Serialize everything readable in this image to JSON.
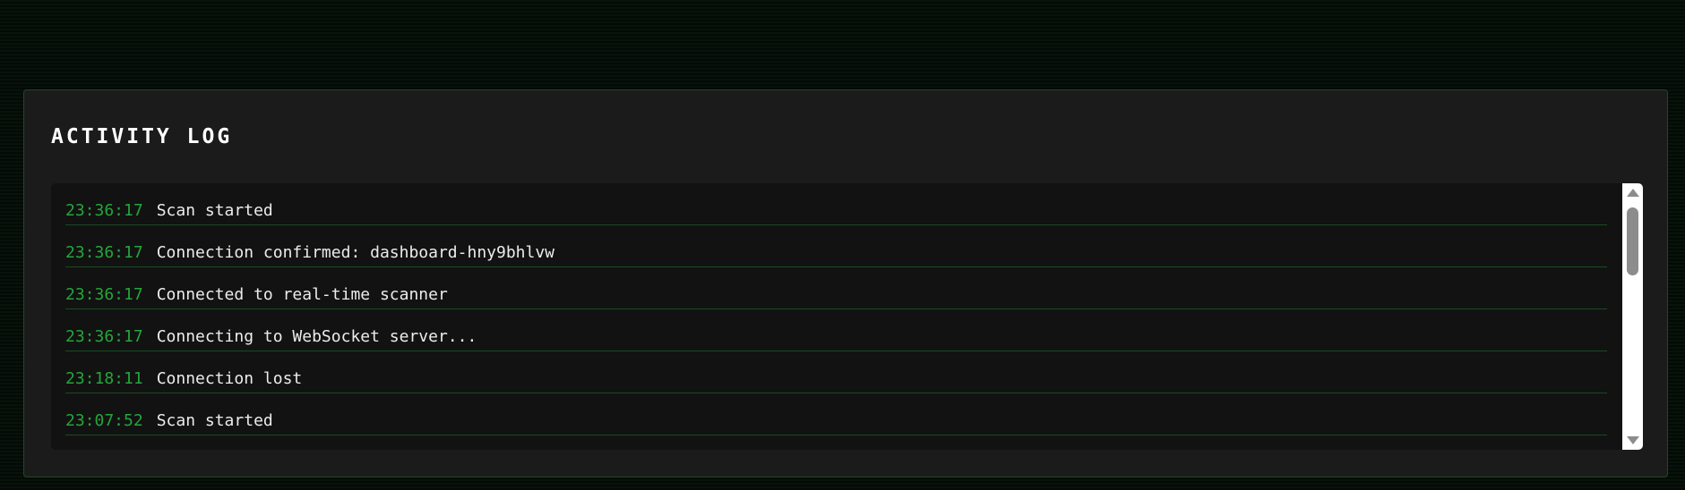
{
  "panel": {
    "title": "ACTIVITY LOG"
  },
  "log": {
    "entries": [
      {
        "time": "23:36:17",
        "message": "Scan started"
      },
      {
        "time": "23:36:17",
        "message": "Connection confirmed: dashboard-hny9bhlvw"
      },
      {
        "time": "23:36:17",
        "message": "Connected to real-time scanner"
      },
      {
        "time": "23:36:17",
        "message": "Connecting to WebSocket server..."
      },
      {
        "time": "23:18:11",
        "message": "Connection lost"
      },
      {
        "time": "23:07:52",
        "message": "Scan started"
      }
    ]
  },
  "colors": {
    "timestamp": "#25a53b",
    "message": "#ececec",
    "panel_border": "#1d4a26",
    "row_divider": "#1a4a24"
  },
  "icons": {
    "scroll_up": "scroll-up-arrow-icon",
    "scroll_down": "scroll-down-arrow-icon"
  }
}
